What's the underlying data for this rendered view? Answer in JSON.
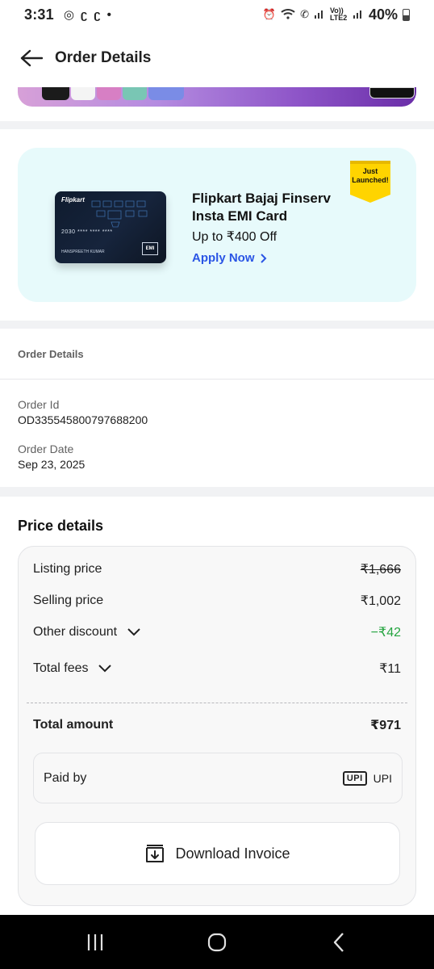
{
  "status_bar": {
    "time": "3:31",
    "battery": "40%",
    "network1": "Vo)) LTE2"
  },
  "header": {
    "title": "Order Details"
  },
  "promo": {
    "card_brand": "Flipkart",
    "card_number": "2030 **** **** ****",
    "card_holder": "HANSPREETH KUMAR",
    "card_emi": "EMI",
    "title_line1": "Flipkart Bajaj Finserv",
    "title_line2": "Insta EMI Card",
    "subtitle": "Up to ₹400 Off",
    "cta": "Apply Now",
    "ribbon_line1": "Just",
    "ribbon_line2": "Launched!"
  },
  "order_details": {
    "heading": "Order Details",
    "order_id_label": "Order Id",
    "order_id": "OD335545800797688200",
    "order_date_label": "Order Date",
    "order_date": "Sep 23, 2025"
  },
  "price_details": {
    "heading": "Price details",
    "rows": [
      {
        "label": "Listing price",
        "value": "₹1,666"
      },
      {
        "label": "Selling price",
        "value": "₹1,002"
      },
      {
        "label": "Other discount",
        "value": "−₹42"
      },
      {
        "label": "Total fees",
        "value": "₹11"
      }
    ],
    "total_label": "Total amount",
    "total_value": "₹971",
    "paid_by_label": "Paid by",
    "payment_badge": "UPI",
    "payment_method": "UPI",
    "download_label": "Download Invoice"
  },
  "colors": {
    "accent": "#2a55e5",
    "discount": "#26a541",
    "promo_bg": "#e7fafb"
  }
}
